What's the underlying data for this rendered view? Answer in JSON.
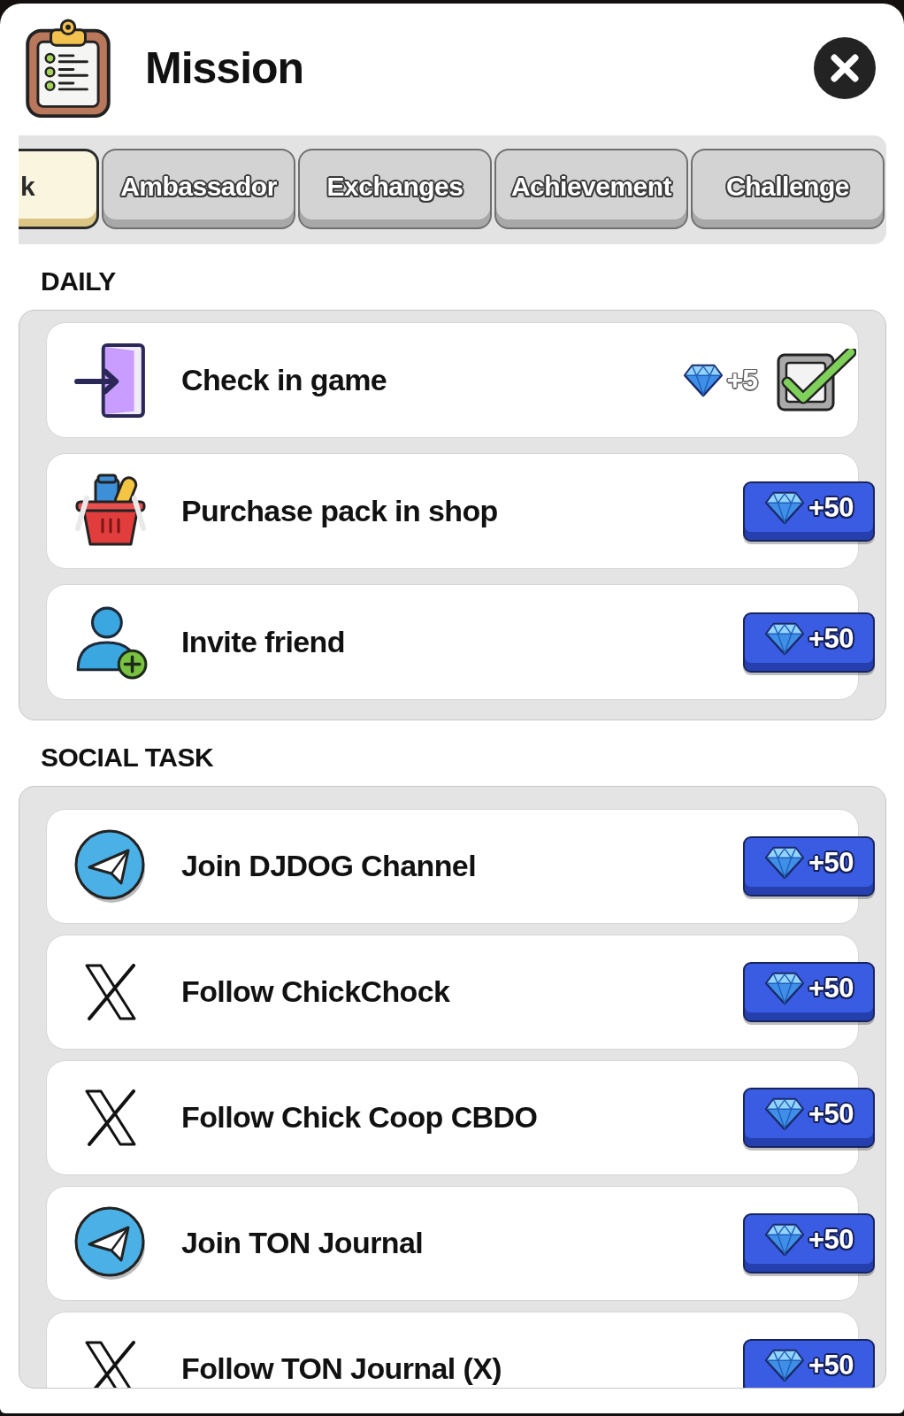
{
  "header": {
    "title": "Mission"
  },
  "tabs": [
    {
      "label": "k",
      "selected": true
    },
    {
      "label": "Ambassador",
      "selected": false
    },
    {
      "label": "Exchanges",
      "selected": false
    },
    {
      "label": "Achievement",
      "selected": false
    },
    {
      "label": "Challenge",
      "selected": false
    }
  ],
  "sections": [
    {
      "title": "DAILY",
      "tasks": [
        {
          "kind": "door",
          "label": "Check in game",
          "reward": "+5",
          "claimed": true
        },
        {
          "kind": "basket",
          "label": "Purchase pack in shop",
          "reward": "+50",
          "claimed": false
        },
        {
          "kind": "person",
          "label": "Invite friend",
          "reward": "+50",
          "claimed": false
        }
      ]
    },
    {
      "title": "SOCIAL TASK",
      "tasks": [
        {
          "kind": "telegram",
          "label": "Join DJDOG Channel",
          "reward": "+50",
          "claimed": false
        },
        {
          "kind": "x",
          "label": "Follow ChickChock",
          "reward": "+50",
          "claimed": false
        },
        {
          "kind": "x",
          "label": "Follow Chick Coop CBDO",
          "reward": "+50",
          "claimed": false
        },
        {
          "kind": "telegram",
          "label": "Join TON Journal",
          "reward": "+50",
          "claimed": false
        },
        {
          "kind": "x",
          "label": "Follow TON Journal (X)",
          "reward": "+50",
          "claimed": false
        }
      ]
    }
  ]
}
